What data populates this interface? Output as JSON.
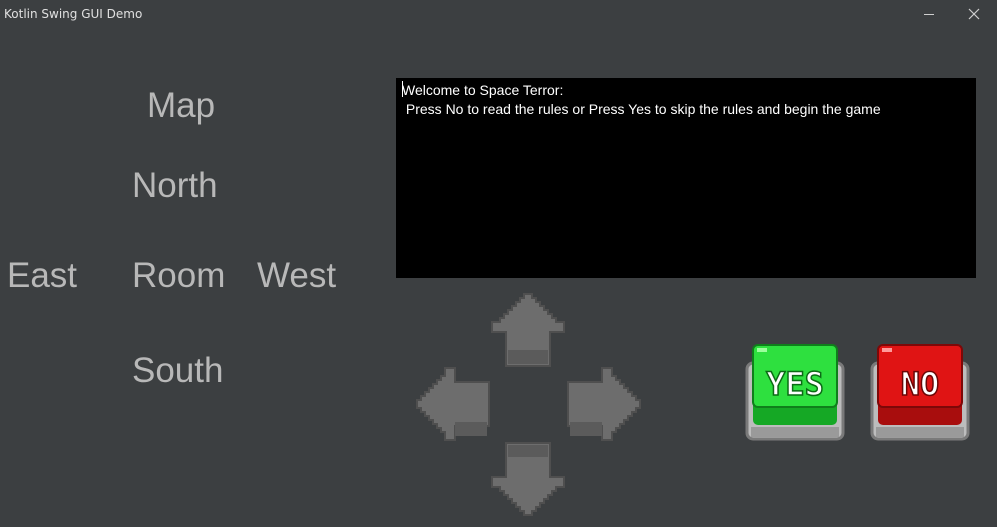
{
  "window": {
    "title": "Kotlin Swing GUI Demo",
    "minimize_icon": "minimize-icon",
    "close_icon": "close-icon"
  },
  "map": {
    "heading": "Map",
    "north": "North",
    "east": "East",
    "room": "Room",
    "west": "West",
    "south": "South"
  },
  "console": {
    "line1": "Welcome to Space Terror:",
    "line2": " Press No to read the rules or Press Yes to skip the rules and begin the game"
  },
  "controls": {
    "up_icon": "arrow-up-icon",
    "down_icon": "arrow-down-icon",
    "left_icon": "arrow-left-icon",
    "right_icon": "arrow-right-icon",
    "yes_label": "YES",
    "no_label": "NO"
  },
  "colors": {
    "background": "#3c3f41",
    "map_text": "#b8b8b8",
    "console_bg": "#000000",
    "console_text": "#ffffff",
    "arrow_fill": "#6a6a6a",
    "yes_green": "#22cc33",
    "no_red": "#dd1111"
  }
}
